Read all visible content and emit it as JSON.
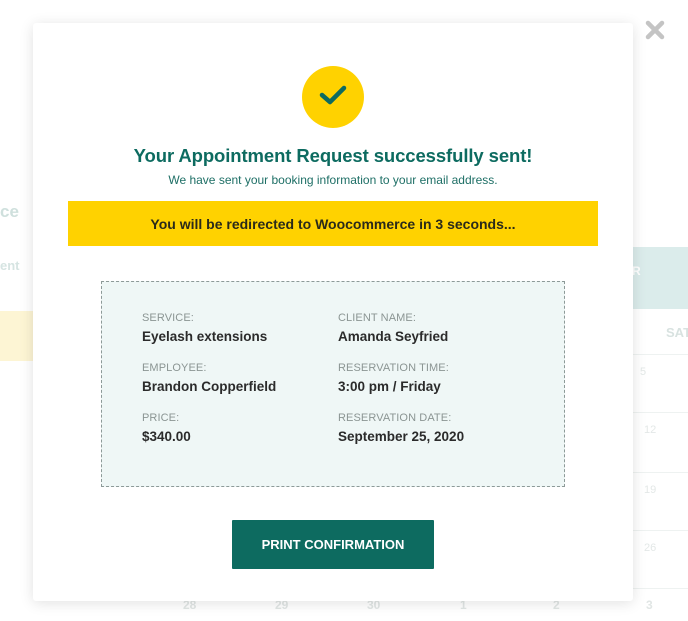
{
  "background": {
    "heading_partial": "ce",
    "label_partial": "ent",
    "month_partial": "ER",
    "weekday_partial": "SAT",
    "cell_numbers": [
      "5",
      "12",
      "19",
      "26"
    ],
    "bottom_row": [
      "28",
      "29",
      "30",
      "1",
      "2",
      "3"
    ]
  },
  "modal": {
    "close_icon": "close-x-icon",
    "success_icon": "check-icon",
    "title": "Your Appointment Request successfully sent!",
    "subtitle": "We have sent your booking information to your email address.",
    "redirect_message": "You will be redirected to Woocommerce in 3 seconds...",
    "details": {
      "service_label": "SERVICE:",
      "service_value": "Eyelash extensions",
      "employee_label": "EMPLOYEE:",
      "employee_value": "Brandon Copperfield",
      "price_label": "PRICE:",
      "price_value": "$340.00",
      "client_label": "CLIENT NAME:",
      "client_value": "Amanda Seyfried",
      "time_label": "RESERVATION TIME:",
      "time_value": "3:00 pm / Friday",
      "date_label": "RESERVATION DATE:",
      "date_value": "September 25, 2020"
    },
    "print_button": "PRINT CONFIRMATION"
  },
  "colors": {
    "primary": "#0d6b60",
    "accent": "#ffd200",
    "details_bg": "#eff7f6"
  }
}
